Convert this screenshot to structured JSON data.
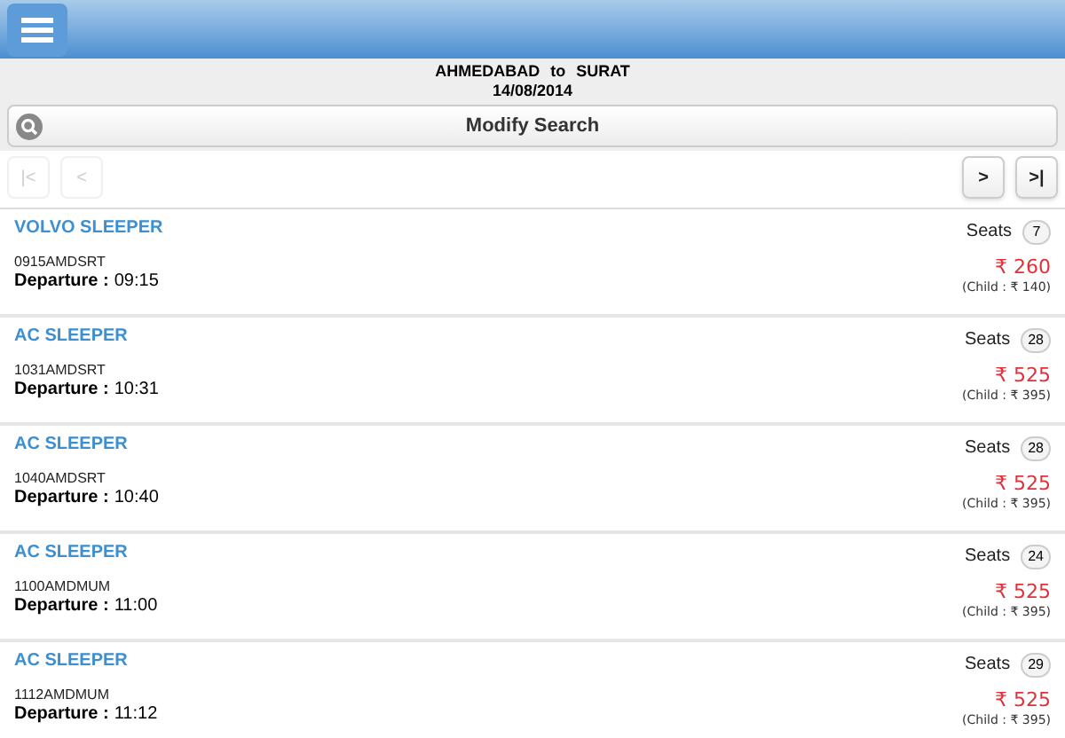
{
  "route": {
    "from": "AHMEDABAD",
    "joiner": "to",
    "to": "SURAT",
    "date": "14/08/2014"
  },
  "modify_search": "Modify Search",
  "pager": [
    {
      "label": "|<",
      "disabled": true
    },
    {
      "label": "<",
      "disabled": true
    },
    {
      "label": ">",
      "disabled": false
    },
    {
      "label": ">|",
      "disabled": false
    }
  ],
  "buses": [
    {
      "type": "VOLVO SLEEPER",
      "code": "0915AMDSRT",
      "departure_label": "Departure :",
      "departure": "09:15",
      "seats_label": "Seats",
      "seats": "7",
      "price": "₹ 260",
      "child": "(Child : ₹ 140)"
    },
    {
      "type": "AC SLEEPER",
      "code": "1031AMDSRT",
      "departure_label": "Departure :",
      "departure": "10:31",
      "seats_label": "Seats",
      "seats": "28",
      "price": "₹ 525",
      "child": "(Child : ₹ 395)"
    },
    {
      "type": "AC SLEEPER",
      "code": "1040AMDSRT",
      "departure_label": "Departure :",
      "departure": "10:40",
      "seats_label": "Seats",
      "seats": "28",
      "price": "₹ 525",
      "child": "(Child : ₹ 395)"
    },
    {
      "type": "AC SLEEPER",
      "code": "1100AMDMUM",
      "departure_label": "Departure :",
      "departure": "11:00",
      "seats_label": "Seats",
      "seats": "24",
      "price": "₹ 525",
      "child": "(Child : ₹ 395)"
    },
    {
      "type": "AC SLEEPER",
      "code": "1112AMDMUM",
      "departure_label": "Departure :",
      "departure": "11:12",
      "seats_label": "Seats",
      "seats": "29",
      "price": "₹ 525",
      "child": "(Child : ₹ 395)"
    }
  ]
}
